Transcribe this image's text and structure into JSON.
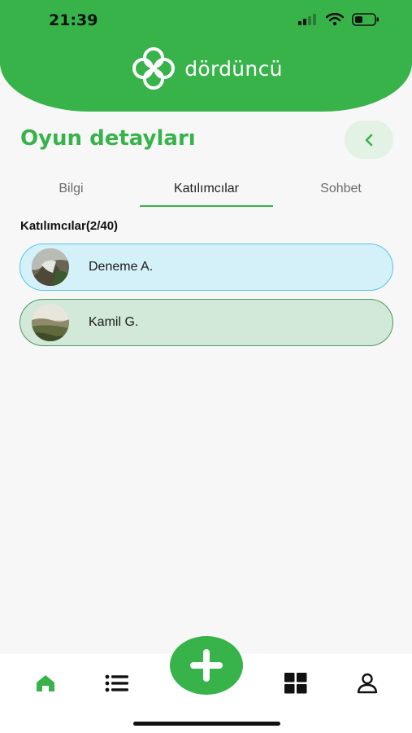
{
  "status_bar": {
    "time": "21:39"
  },
  "brand": {
    "name": "dördüncü"
  },
  "page": {
    "title": "Oyun detayları"
  },
  "tabs": [
    {
      "label": "Bilgi"
    },
    {
      "label": "Katılımcılar"
    },
    {
      "label": "Sohbet"
    }
  ],
  "participants": {
    "header": "Katılımcılar(2/40)",
    "items": [
      {
        "name": "Deneme A."
      },
      {
        "name": "Kamil G."
      }
    ]
  },
  "colors": {
    "brand": "#37b34a",
    "participant_1_bg": "#d4f1f9",
    "participant_2_bg": "#d2e8d8"
  },
  "icons": {
    "back": "chevron-left-icon",
    "home": "home-icon",
    "list": "list-icon",
    "add": "plus-icon",
    "grid": "grid-icon",
    "profile": "user-icon"
  }
}
